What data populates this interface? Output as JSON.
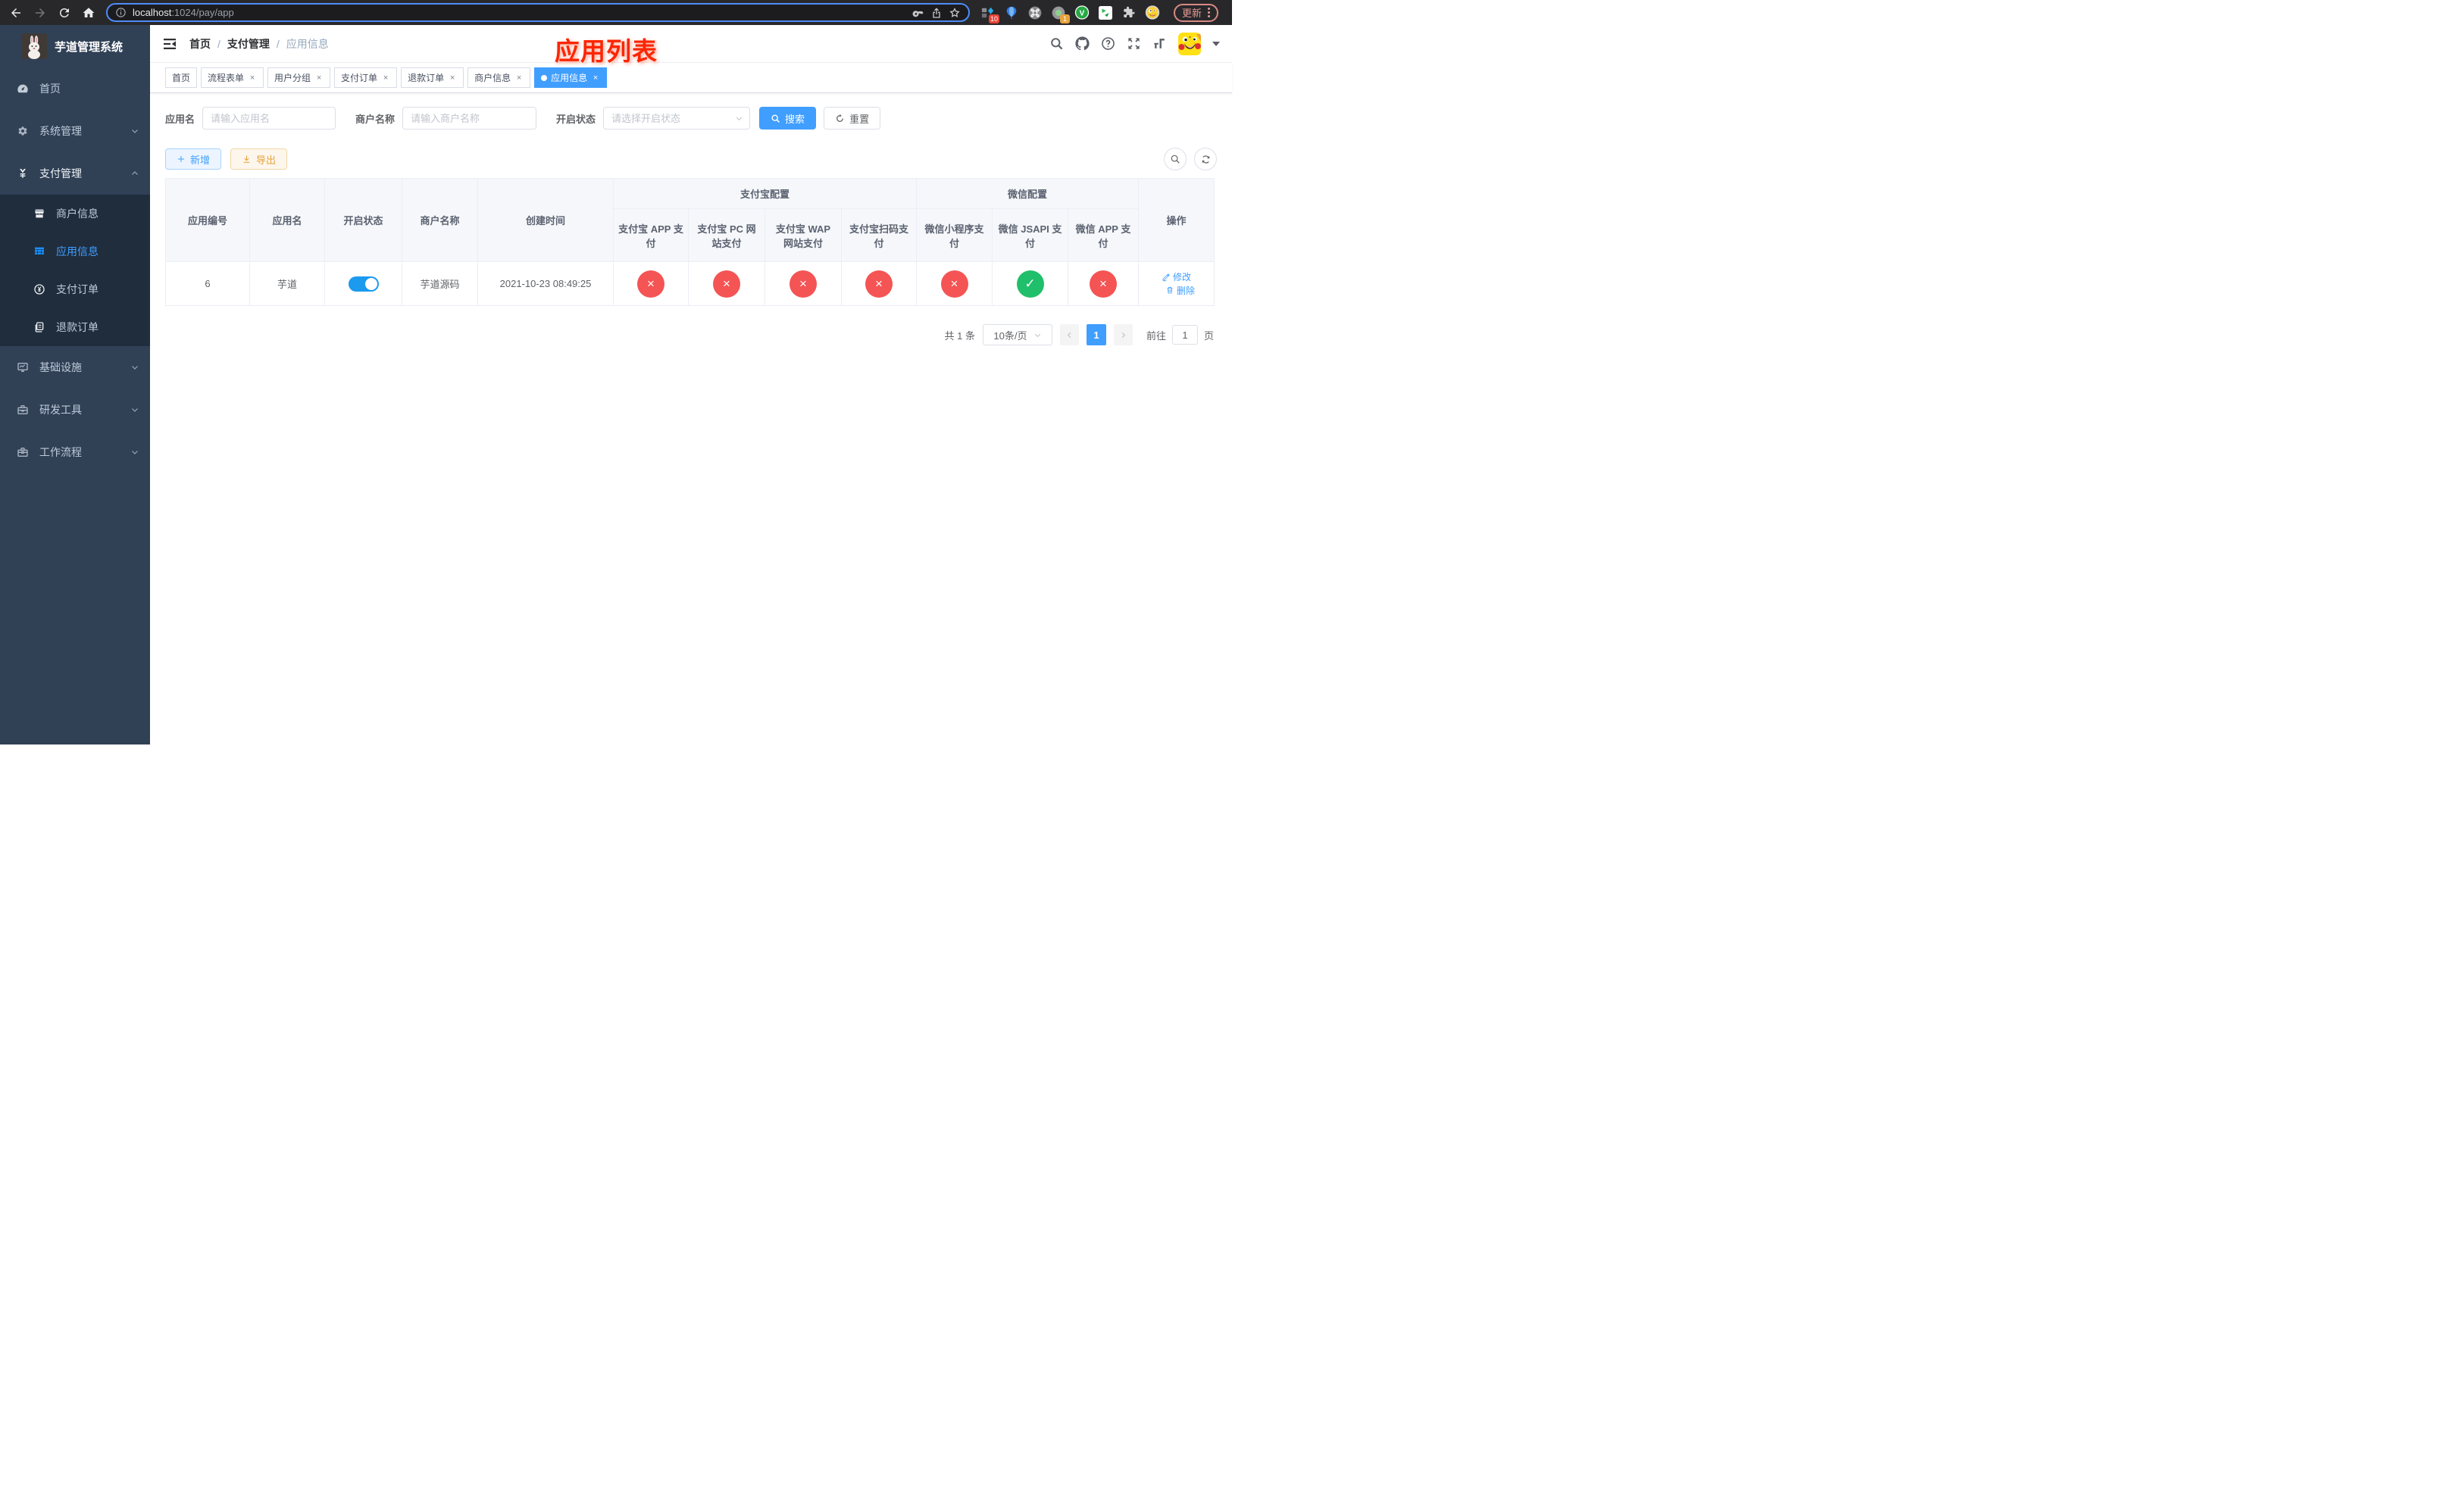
{
  "browser": {
    "url_host": "localhost",
    "url_path": ":1024/pay/app",
    "update_label": "更新",
    "ext_badge_blue": "10",
    "ext_badge_orange": "1",
    "ext_v_letter": "V"
  },
  "sidebar": {
    "title": "芋道管理系统",
    "items": [
      {
        "label": "首页"
      },
      {
        "label": "系统管理"
      },
      {
        "label": "支付管理"
      },
      {
        "label": "商户信息"
      },
      {
        "label": "应用信息"
      },
      {
        "label": "支付订单"
      },
      {
        "label": "退款订单"
      },
      {
        "label": "基础设施"
      },
      {
        "label": "研发工具"
      },
      {
        "label": "工作流程"
      }
    ]
  },
  "navbar": {
    "breadcrumb": {
      "home": "首页",
      "section": "支付管理",
      "current": "应用信息"
    }
  },
  "annotation": "应用列表",
  "tabs": [
    {
      "label": "首页"
    },
    {
      "label": "流程表单"
    },
    {
      "label": "用户分组"
    },
    {
      "label": "支付订单"
    },
    {
      "label": "退款订单"
    },
    {
      "label": "商户信息"
    },
    {
      "label": "应用信息"
    }
  ],
  "filters": {
    "app_name_label": "应用名",
    "app_name_placeholder": "请输入应用名",
    "merchant_label": "商户名称",
    "merchant_placeholder": "请输入商户名称",
    "status_label": "开启状态",
    "status_placeholder": "请选择开启状态",
    "search_label": "搜索",
    "reset_label": "重置"
  },
  "toolbar": {
    "add_label": "新增",
    "export_label": "导出"
  },
  "table": {
    "columns": {
      "app_id": "应用编号",
      "app_name": "应用名",
      "status": "开启状态",
      "merchant": "商户名称",
      "created": "创建时间",
      "alipay_group": "支付宝配置",
      "wechat_group": "微信配置",
      "alipay_app": "支付宝 APP 支付",
      "alipay_pc": "支付宝 PC 网站支付",
      "alipay_wap": "支付宝 WAP 网站支付",
      "alipay_qr": "支付宝扫码支付",
      "wx_mini": "微信小程序支付",
      "wx_jsapi": "微信 JSAPI 支付",
      "wx_app": "微信 APP 支付",
      "actions": "操作"
    },
    "row": {
      "app_id": "6",
      "app_name": "芋道",
      "status_on": true,
      "merchant": "芋道源码",
      "created": "2021-10-23 08:49:25",
      "alipay_app": "disabled",
      "alipay_pc": "disabled",
      "alipay_wap": "disabled",
      "alipay_qr": "disabled",
      "wx_mini": "disabled",
      "wx_jsapi": "enabled",
      "wx_app": "disabled",
      "edit_label": "修改",
      "delete_label": "删除"
    }
  },
  "pagination": {
    "total": "共 1 条",
    "page_size": "10条/页",
    "page": "1",
    "goto_label": "前往",
    "goto_value": "1",
    "goto_suffix": "页"
  },
  "colors": {
    "accent": "#409eff",
    "danger": "#f45454",
    "success": "#20bf6b",
    "warning": "#e6a23c",
    "sidebar_bg": "#304156",
    "submenu_bg": "#1f2d3d",
    "annotation_red": "#fb2604"
  }
}
